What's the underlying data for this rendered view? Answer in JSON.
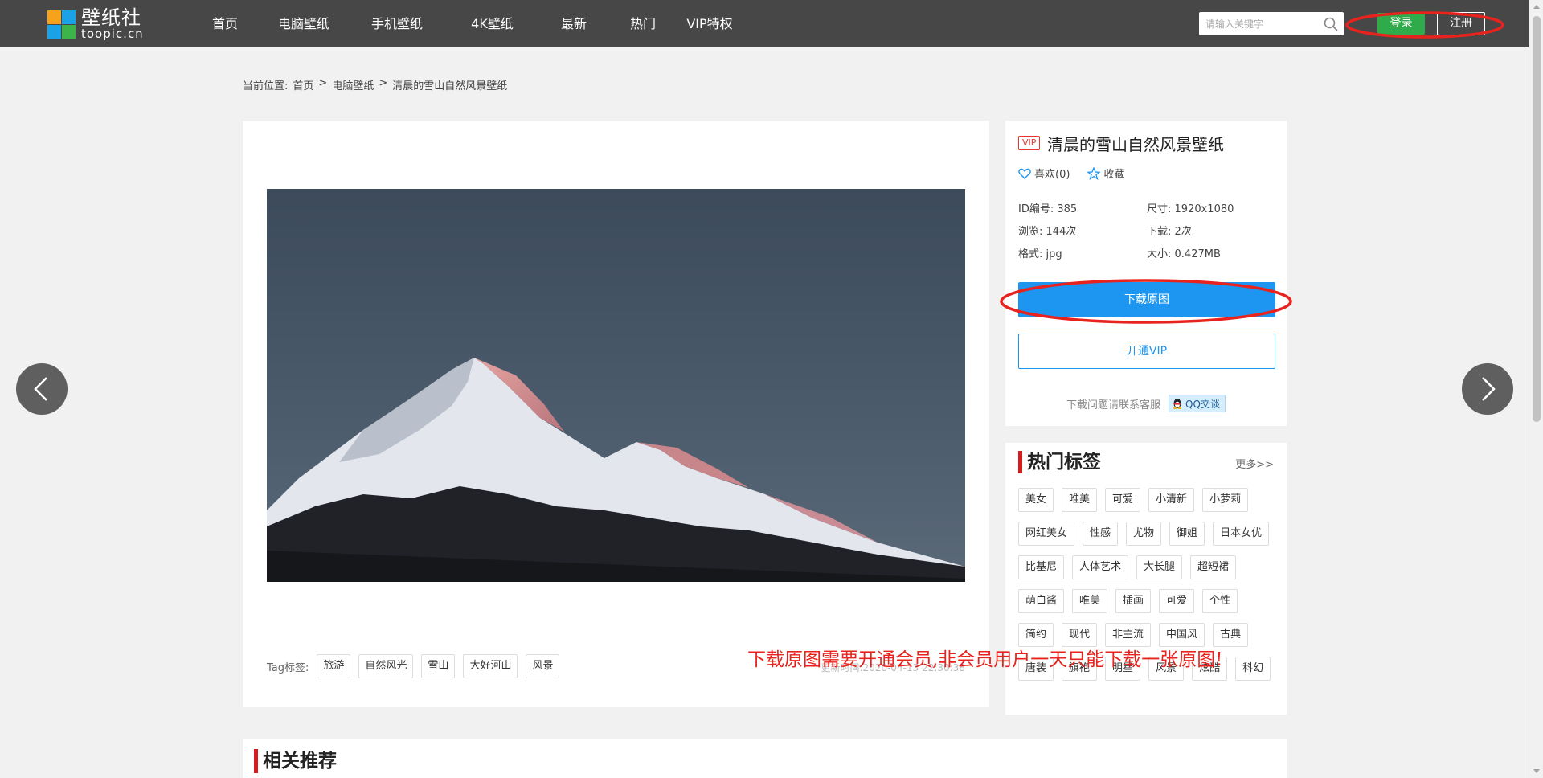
{
  "header": {
    "logo_name": "壁纸社",
    "logo_domain": "toopic.cn",
    "nav": [
      "首页",
      "电脑壁纸",
      "手机壁纸",
      "4K壁纸",
      "最新",
      "热门",
      "VIP特权"
    ],
    "search_placeholder": "请输入关键字",
    "login_label": "登录",
    "register_label": "注册"
  },
  "breadcrumb": {
    "prefix": "当前位置:",
    "items": [
      "首页",
      "电脑壁纸",
      "清晨的雪山自然风景壁纸"
    ],
    "separator": ">"
  },
  "main": {
    "tags_label": "Tag标签:",
    "tags": [
      "旅游",
      "自然风光",
      "雪山",
      "大好河山",
      "风景"
    ],
    "update_time": "更新时间:2020-04-13 22:30:38"
  },
  "info": {
    "vip_badge": "VIP",
    "title": "清晨的雪山自然风景壁纸",
    "like_label": "喜欢(0)",
    "fav_label": "收藏",
    "id_label": "ID编号:",
    "id_value": "385",
    "size_label": "尺寸:",
    "size_value": "1920x1080",
    "views_label": "浏览:",
    "views_value": "144次",
    "downloads_label": "下载:",
    "downloads_value": "2次",
    "format_label": "格式:",
    "format_value": "jpg",
    "filesize_label": "大小:",
    "filesize_value": "0.427MB",
    "download_button": "下载原图",
    "vip_button": "开通VIP",
    "contact_text": "下载问题请联系客服",
    "qq_label": "QQ交谈"
  },
  "hot_tags": {
    "title": "热门标签",
    "more": "更多>>",
    "tags": [
      "美女",
      "唯美",
      "可爱",
      "小清新",
      "小萝莉",
      "网红美女",
      "性感",
      "尤物",
      "御姐",
      "日本女优",
      "比基尼",
      "人体艺术",
      "大长腿",
      "超短裙",
      "萌白酱",
      "唯美",
      "插画",
      "可爱",
      "个性",
      "简约",
      "现代",
      "非主流",
      "中国风",
      "古典",
      "唐装",
      "旗袍",
      "明星",
      "风景",
      "炫酷",
      "科幻"
    ]
  },
  "related": {
    "title": "相关推荐"
  },
  "annotation": {
    "text": "下载原图需要开通会员,非会员用户一天只能下载一张原图!"
  },
  "colors": {
    "header_bg": "#474747",
    "login_green": "#2fab4b",
    "download_blue": "#1c96f1",
    "accent_red": "#d91b1b",
    "annotation_red": "#e8231d"
  }
}
